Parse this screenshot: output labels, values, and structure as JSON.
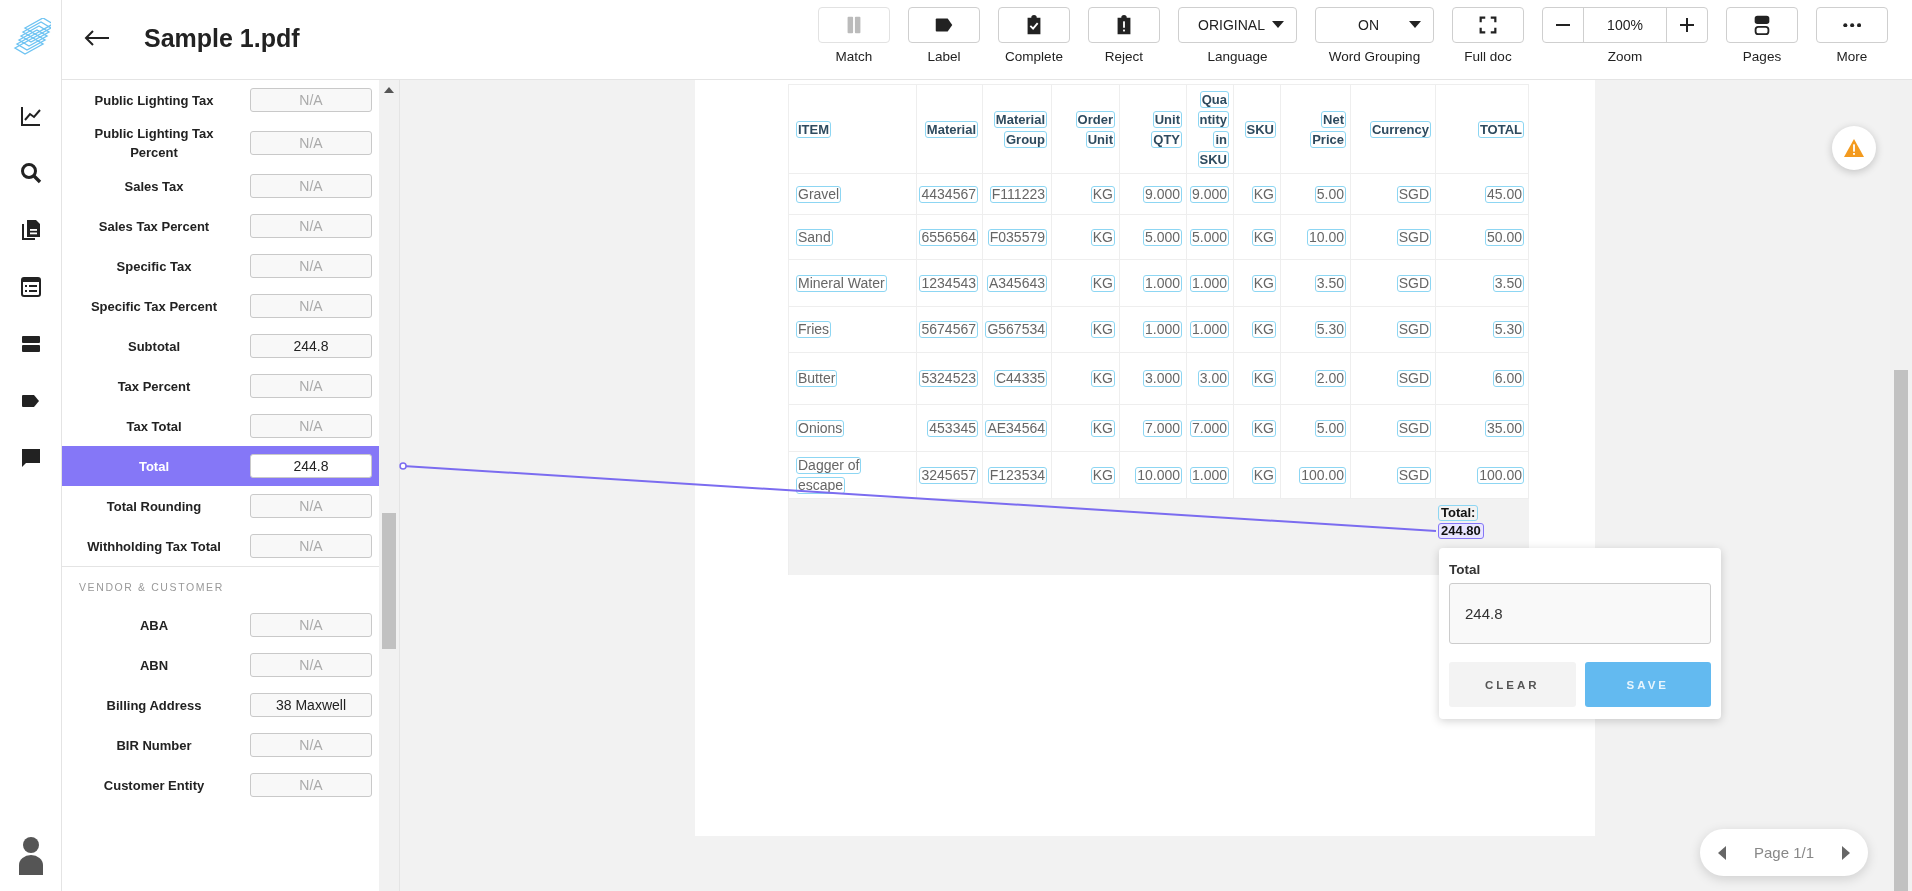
{
  "header": {
    "title": "Sample 1.pdf"
  },
  "toolbar": [
    {
      "kind": "button",
      "label": "Match",
      "disabled": true
    },
    {
      "kind": "button",
      "label": "Label",
      "disabled": false
    },
    {
      "kind": "button",
      "label": "Complete",
      "disabled": false
    },
    {
      "kind": "button",
      "label": "Reject",
      "disabled": false
    },
    {
      "kind": "dropdown",
      "value": "ORIGINAL",
      "label": "Language"
    },
    {
      "kind": "dropdown",
      "value": "ON",
      "label": "Word Grouping"
    },
    {
      "kind": "button",
      "label": "Full doc",
      "disabled": false
    },
    {
      "kind": "zoom",
      "value": "100%",
      "label": "Zoom"
    },
    {
      "kind": "button",
      "label": "Pages",
      "disabled": false
    },
    {
      "kind": "button",
      "label": "More",
      "disabled": false
    }
  ],
  "form": {
    "sections": [
      {
        "fields": [
          {
            "label": "Public Lighting Tax",
            "placeholder": "N/A",
            "selected": false
          },
          {
            "label": "Public Lighting Tax Percent",
            "placeholder": "N/A",
            "selected": false
          },
          {
            "label": "Sales Tax",
            "placeholder": "N/A",
            "selected": false
          },
          {
            "label": "Sales Tax Percent",
            "placeholder": "N/A",
            "selected": false
          },
          {
            "label": "Specific Tax",
            "placeholder": "N/A",
            "selected": false
          },
          {
            "label": "Specific Tax Percent",
            "placeholder": "N/A",
            "selected": false
          },
          {
            "label": "Subtotal",
            "value": "244.8",
            "selected": false
          },
          {
            "label": "Tax Percent",
            "placeholder": "N/A",
            "selected": false
          },
          {
            "label": "Tax Total",
            "placeholder": "N/A",
            "selected": false
          },
          {
            "label": "Total",
            "value": "244.8",
            "selected": true
          },
          {
            "label": "Total Rounding",
            "placeholder": "N/A",
            "selected": false
          },
          {
            "label": "Withholding Tax Total",
            "placeholder": "N/A",
            "selected": false
          }
        ]
      },
      {
        "title": "VENDOR & CUSTOMER",
        "fields": [
          {
            "label": "ABA",
            "placeholder": "N/A",
            "selected": false
          },
          {
            "label": "ABN",
            "placeholder": "N/A",
            "selected": false
          },
          {
            "label": "Billing Address",
            "value": "38 Maxwell",
            "selected": false
          },
          {
            "label": "BIR Number",
            "placeholder": "N/A",
            "selected": false
          },
          {
            "label": "Customer Entity",
            "placeholder": "N/A",
            "selected": false
          }
        ]
      }
    ]
  },
  "document": {
    "table": {
      "columns": [
        {
          "lines": [
            "ITEM"
          ]
        },
        {
          "lines": [
            "Material"
          ]
        },
        {
          "lines": [
            "Material",
            "Group"
          ]
        },
        {
          "lines": [
            "Order",
            "Unit"
          ]
        },
        {
          "lines": [
            "Unit",
            "QTY"
          ]
        },
        {
          "lines": [
            "Qua",
            "ntity",
            "in",
            "SKU"
          ]
        },
        {
          "lines": [
            "SKU"
          ]
        },
        {
          "lines": [
            "Net",
            "Price"
          ]
        },
        {
          "lines": [
            "Currency"
          ]
        },
        {
          "lines": [
            "TOTAL"
          ]
        }
      ],
      "rows": [
        [
          [
            "Gravel"
          ],
          [
            "4434567"
          ],
          [
            "F111223"
          ],
          [
            "KG"
          ],
          [
            "9.000"
          ],
          [
            "9.000"
          ],
          [
            "KG"
          ],
          [
            "5.00"
          ],
          [
            "SGD"
          ],
          [
            "45.00"
          ]
        ],
        [
          [
            "Sand"
          ],
          [
            "6556564"
          ],
          [
            "F035579"
          ],
          [
            "KG"
          ],
          [
            "5.000"
          ],
          [
            "5.000"
          ],
          [
            "KG"
          ],
          [
            "10.00"
          ],
          [
            "SGD"
          ],
          [
            "50.00"
          ]
        ],
        [
          [
            "Mineral Water"
          ],
          [
            "1234543"
          ],
          [
            "A345643"
          ],
          [
            "KG"
          ],
          [
            "1.000"
          ],
          [
            "1.000"
          ],
          [
            "KG"
          ],
          [
            "3.50"
          ],
          [
            "SGD"
          ],
          [
            "3.50"
          ]
        ],
        [
          [
            "Fries"
          ],
          [
            "5674567"
          ],
          [
            "G567534"
          ],
          [
            "KG"
          ],
          [
            "1.000"
          ],
          [
            "1.000"
          ],
          [
            "KG"
          ],
          [
            "5.30"
          ],
          [
            "SGD"
          ],
          [
            "5.30"
          ]
        ],
        [
          [
            "Butter"
          ],
          [
            "5324523"
          ],
          [
            "C44335"
          ],
          [
            "KG"
          ],
          [
            "3.000"
          ],
          [
            "3.00"
          ],
          [
            "KG"
          ],
          [
            "2.00"
          ],
          [
            "SGD"
          ],
          [
            "6.00"
          ]
        ],
        [
          [
            "Onions"
          ],
          [
            "453345"
          ],
          [
            "AE34564"
          ],
          [
            "KG"
          ],
          [
            "7.000"
          ],
          [
            "7.000"
          ],
          [
            "KG"
          ],
          [
            "5.00"
          ],
          [
            "SGD"
          ],
          [
            "35.00"
          ]
        ],
        [
          [
            "Dagger of",
            "escape"
          ],
          [
            "3245657"
          ],
          [
            "F123534"
          ],
          [
            "KG"
          ],
          [
            "10.000"
          ],
          [
            "1.000"
          ],
          [
            "KG"
          ],
          [
            "100.00"
          ],
          [
            "SGD"
          ],
          [
            "100.00"
          ]
        ]
      ],
      "total": {
        "label": "Total:",
        "value": "244.80",
        "selected": true
      }
    }
  },
  "popup": {
    "field_label": "Total",
    "value": "244.8",
    "buttons": [
      {
        "kind": "secondary",
        "label": "CLEAR"
      },
      {
        "kind": "primary",
        "label": "SAVE"
      }
    ]
  },
  "pager": {
    "text": "Page 1/1"
  }
}
